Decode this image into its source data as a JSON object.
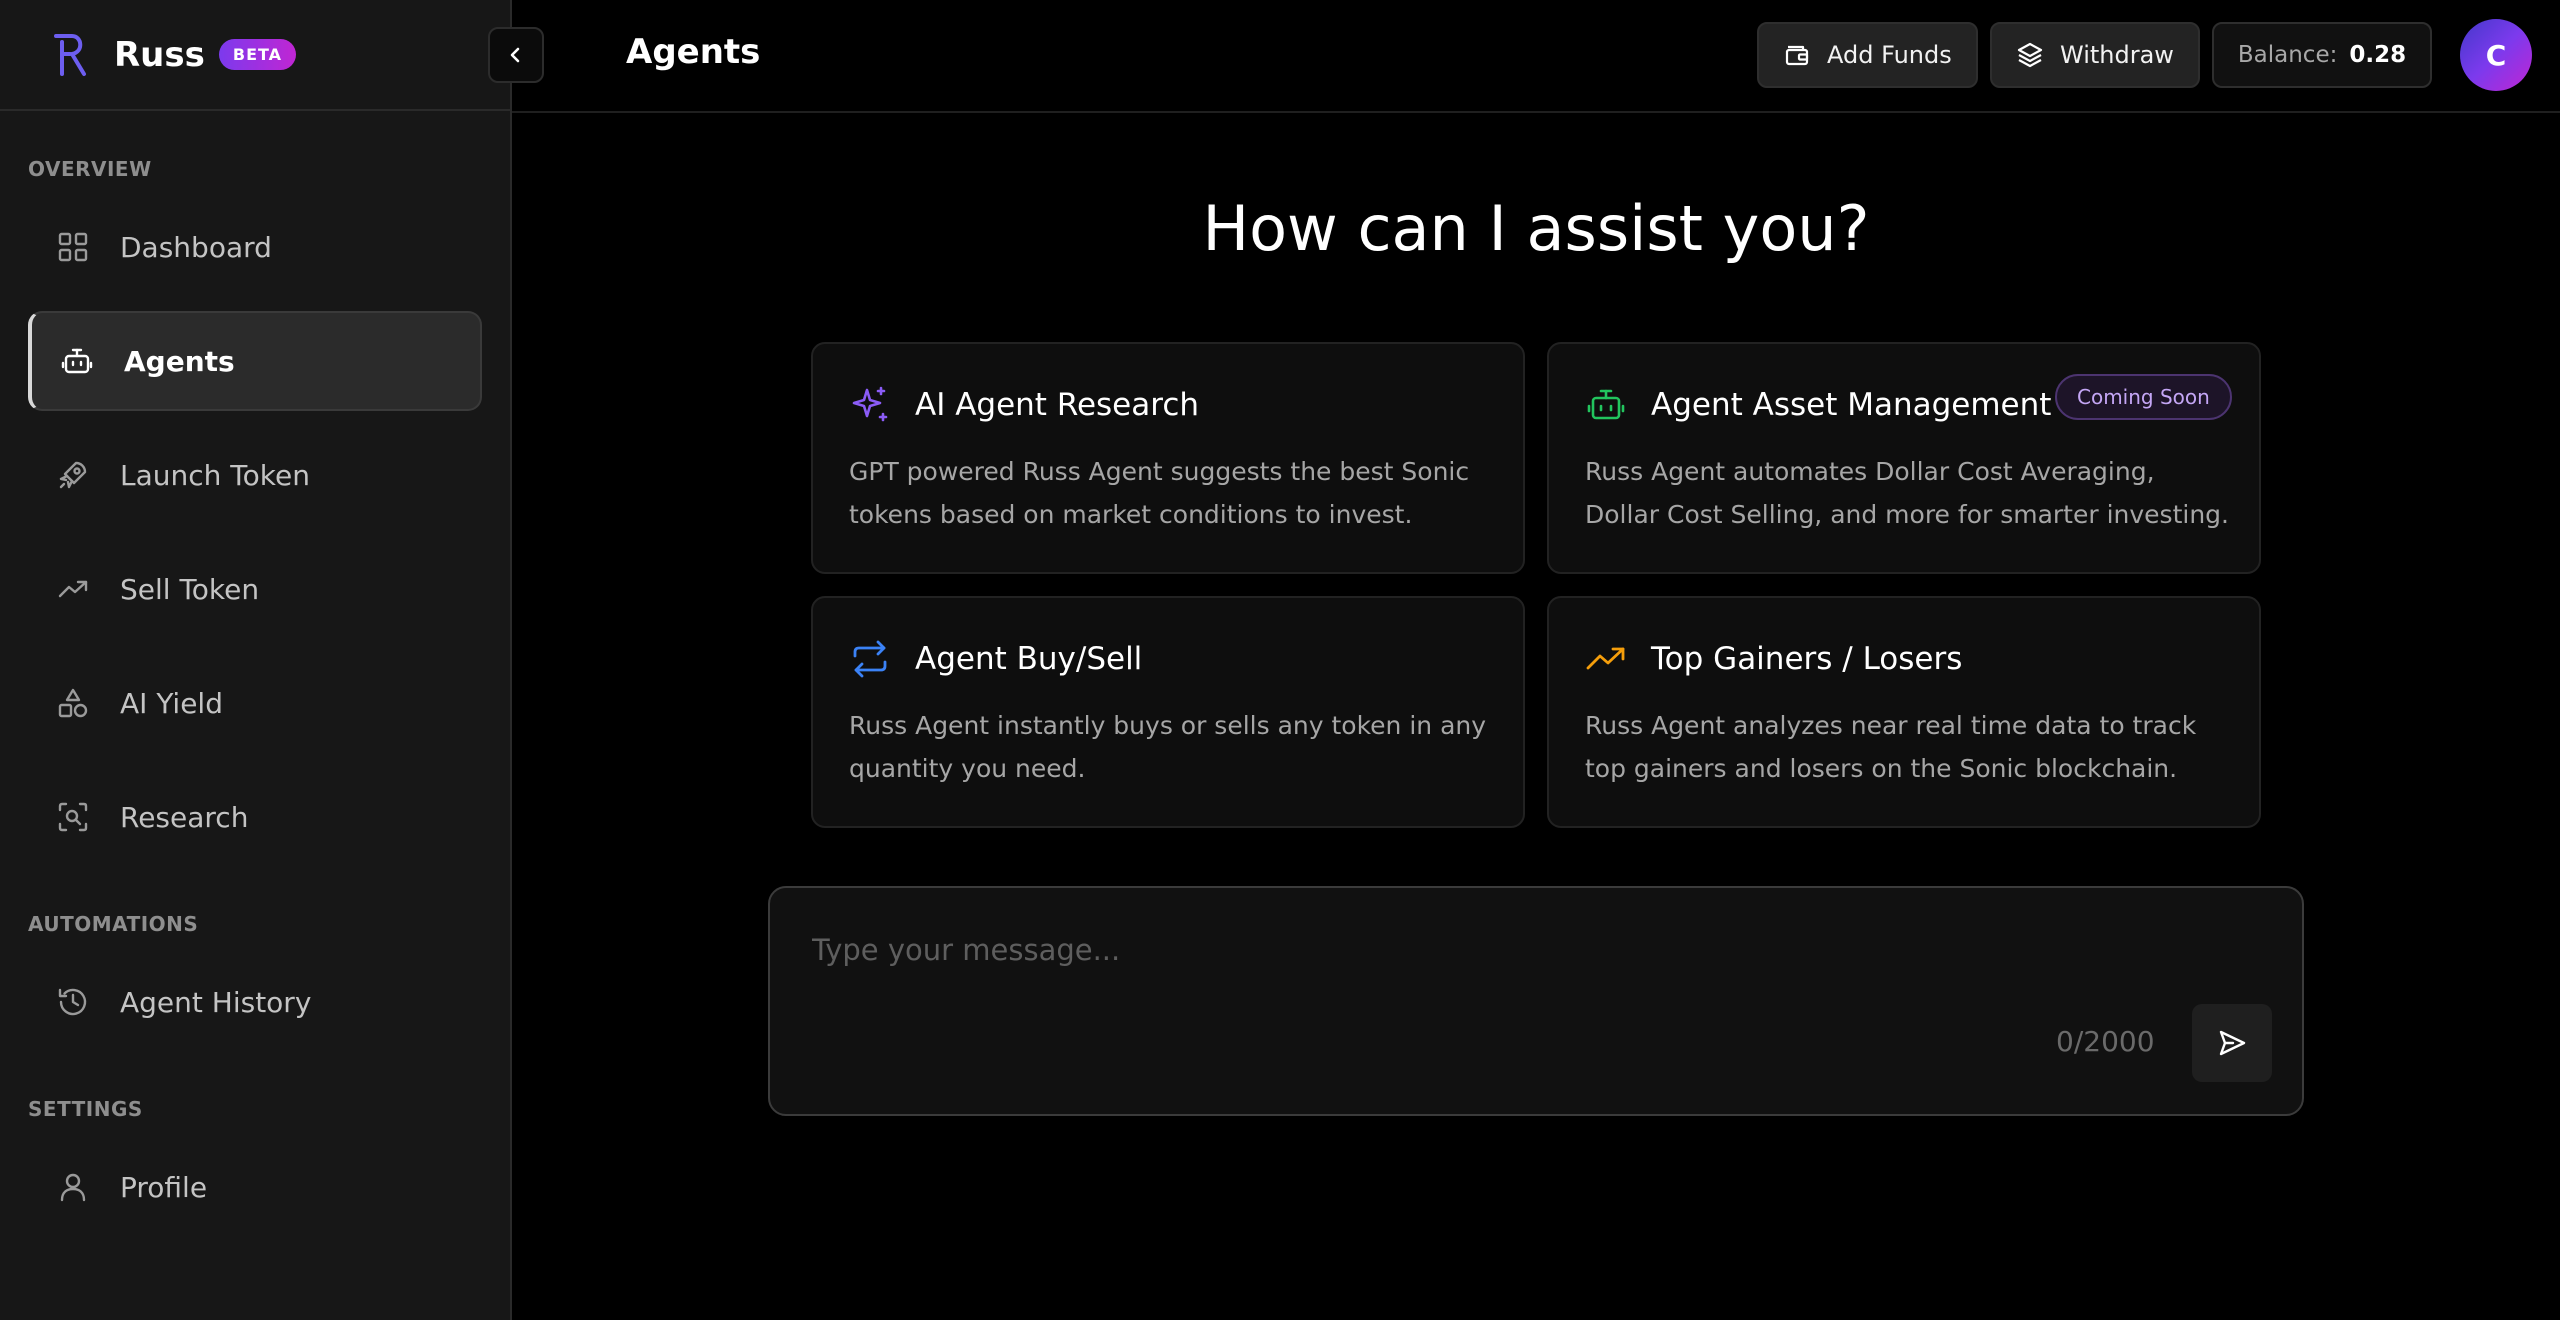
{
  "brand": {
    "name": "Russ",
    "badge": "BETA"
  },
  "sidebar": {
    "sections": {
      "overview": "OVERVIEW",
      "automations": "AUTOMATIONS",
      "settings": "SETTINGS"
    },
    "items": {
      "dashboard": "Dashboard",
      "agents": "Agents",
      "launch_token": "Launch Token",
      "sell_token": "Sell Token",
      "ai_yield": "AI Yield",
      "research": "Research",
      "agent_history": "Agent History",
      "profile": "Profile"
    },
    "active_item": "agents"
  },
  "header": {
    "title": "Agents",
    "add_funds_label": "Add Funds",
    "withdraw_label": "Withdraw",
    "balance_label": "Balance:",
    "balance_value": "0.28",
    "avatar_initial": "C"
  },
  "main": {
    "headline": "How can I assist you?",
    "cards": {
      "research": {
        "title": "AI Agent Research",
        "description": "GPT powered Russ Agent suggests the best Sonic tokens based on market conditions to invest."
      },
      "asset_management": {
        "title": "Agent Asset Management",
        "badge": "Coming Soon",
        "description": "Russ Agent automates Dollar Cost Averaging, Dollar Cost Selling, and more for smarter investing."
      },
      "buy_sell": {
        "title": "Agent Buy/Sell",
        "description": "Russ Agent instantly buys or sells any token in any quantity you need."
      },
      "gainers_losers": {
        "title": "Top Gainers / Losers",
        "description": "Russ Agent analyzes near real time data to track top gainers and losers on the Sonic blockchain."
      }
    },
    "composer": {
      "placeholder": "Type your message...",
      "value": "",
      "char_count": "0/2000"
    }
  },
  "colors": {
    "background": "#000000",
    "sidebar": "#171717",
    "research_icon": "#8b5cf6",
    "asset_icon": "#22c55e",
    "buysell_icon": "#3b82f6",
    "gainers_icon": "#f59e0b",
    "brand_gradient_start": "#7c3aed",
    "brand_gradient_end": "#c026d3"
  },
  "icons": {
    "collapse": "chevron-left-icon",
    "dashboard": "grid-icon",
    "agents": "robot-icon",
    "launch_token": "rocket-icon",
    "sell_token": "trend-up-icon",
    "ai_yield": "shapes-icon",
    "research": "scan-search-icon",
    "agent_history": "history-icon",
    "profile": "user-icon",
    "add_funds": "wallet-icon",
    "withdraw": "layers-icon",
    "send": "send-icon",
    "research_card": "sparkles-icon",
    "asset_card": "robot-icon",
    "buysell_card": "repeat-icon",
    "gainers_card": "trend-up-icon"
  }
}
